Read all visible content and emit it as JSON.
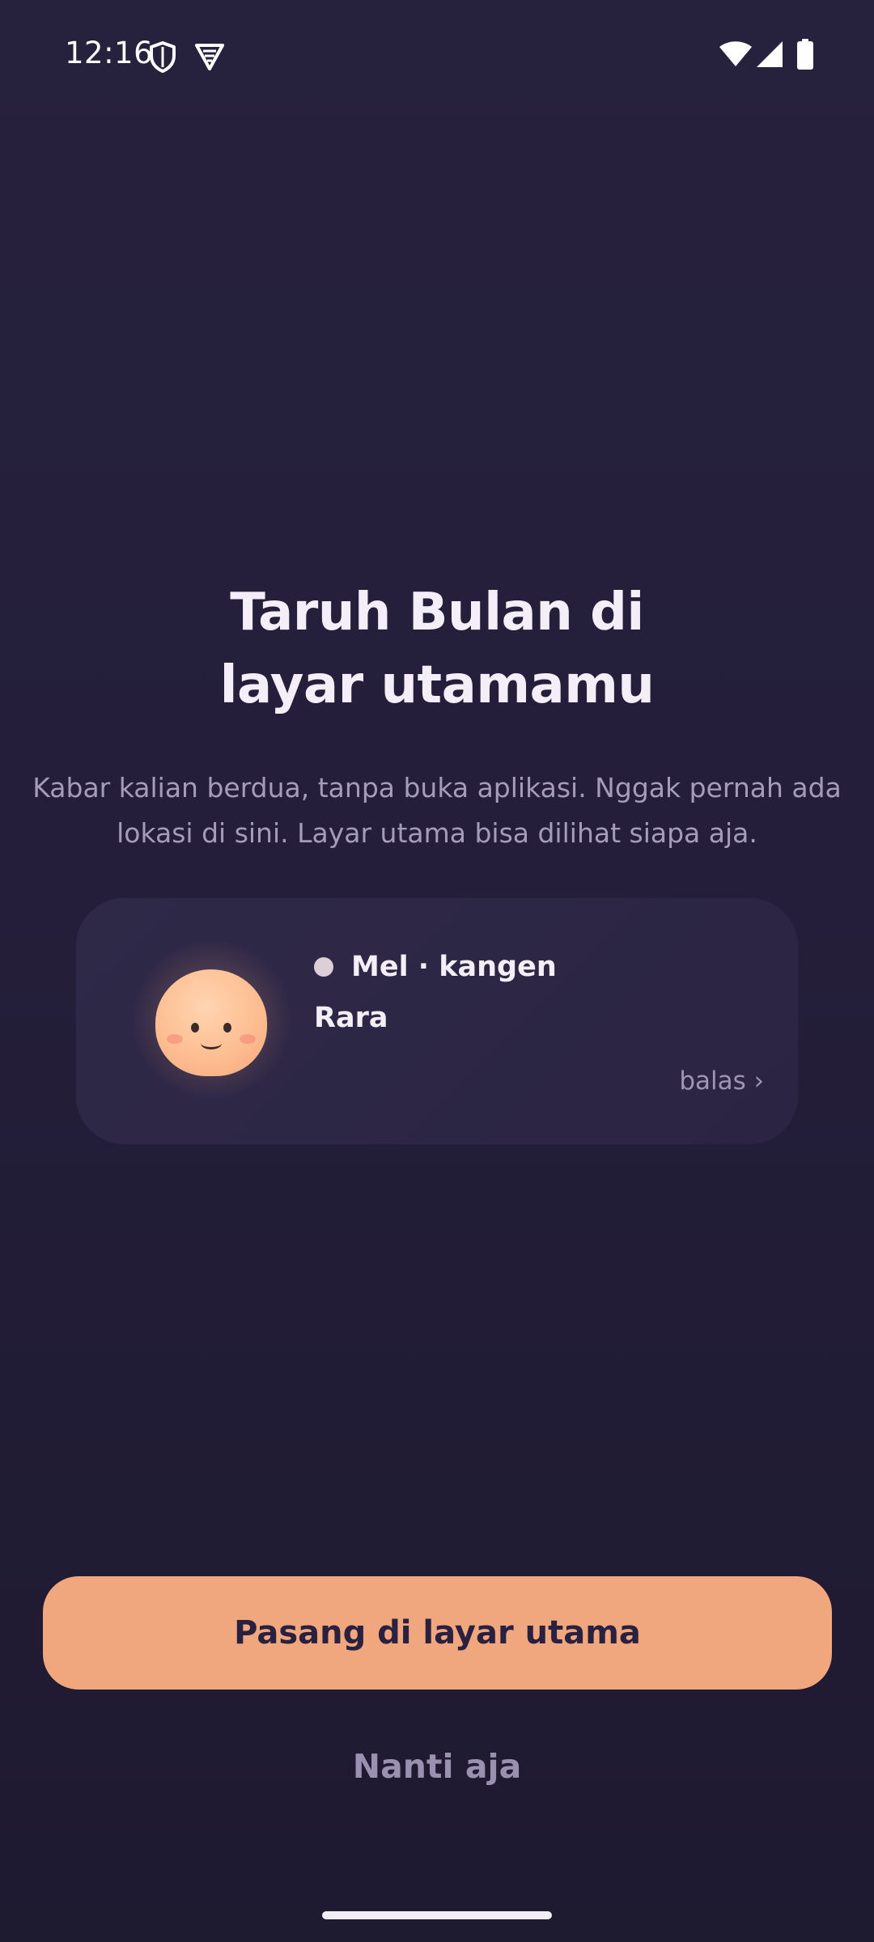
{
  "status_bar": {
    "time": "12:16",
    "icons_left": [
      "shield-icon",
      "vpn-icon"
    ],
    "icons_right": [
      "wifi-icon",
      "signal-icon",
      "battery-icon"
    ]
  },
  "onboarding": {
    "title_line1": "Taruh Bulan di",
    "title_line2": "layar utamamu",
    "subtitle": "Kabar kalian berdua, tanpa buka aplikasi. Nggak pernah ada lokasi di sini. Layar utama bisa dilihat siapa aja."
  },
  "widget_preview": {
    "avatar_icon": "moon-face-icon",
    "status_line": "Mel · kangen",
    "partner_name": "Rara",
    "reply_link": "balas ›"
  },
  "actions": {
    "primary_label": "Pasang di layar utama",
    "secondary_label": "Nanti aja"
  },
  "colors": {
    "background": "#241e3a",
    "card": "#2d2746",
    "accent": "#f0a77e",
    "muted_text": "#a49cb8"
  }
}
